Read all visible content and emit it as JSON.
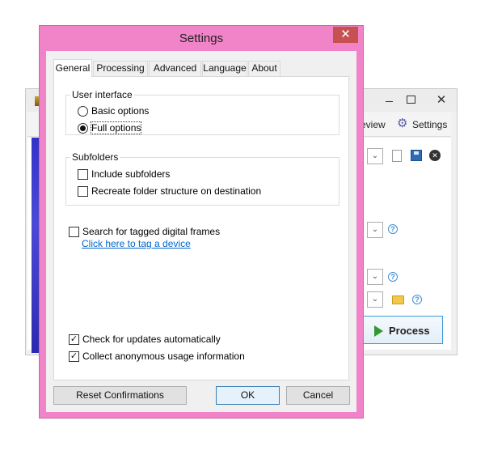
{
  "background_window": {
    "toolbar": {
      "review_label": "eview",
      "settings_label": "Settings"
    },
    "process_label": "Process",
    "close_glyph": "✕",
    "dropdown_glyph": "⌄",
    "help_glyph": "?",
    "delete_glyph": "✕",
    "icons": [
      "app-icon",
      "file-icon",
      "save-icon",
      "delete-icon",
      "folder-icon",
      "help-icon",
      "play-icon",
      "gear-icon"
    ]
  },
  "dialog": {
    "title": "Settings",
    "close_glyph": "✕",
    "accent_color": "#f183c8",
    "tabs": [
      {
        "label": "General",
        "active": true
      },
      {
        "label": "Processing"
      },
      {
        "label": "Advanced"
      },
      {
        "label": "Language"
      },
      {
        "label": "About"
      }
    ],
    "general": {
      "user_interface": {
        "legend": "User interface",
        "options": [
          {
            "label": "Basic options",
            "selected": false
          },
          {
            "label": "Full options",
            "selected": true
          }
        ]
      },
      "subfolders": {
        "legend": "Subfolders",
        "options": [
          {
            "label": "Include subfolders",
            "checked": false
          },
          {
            "label": "Recreate folder structure on destination",
            "checked": false
          }
        ]
      },
      "search_tagged": {
        "label": "Search for tagged digital frames",
        "checked": false
      },
      "tag_link": "Click here to tag a device",
      "check_updates": {
        "label": "Check for updates automatically",
        "checked": true
      },
      "collect_usage": {
        "label": "Collect anonymous usage information",
        "checked": true
      },
      "check_glyph": "✓"
    },
    "buttons": {
      "reset": "Reset Confirmations",
      "ok": "OK",
      "cancel": "Cancel"
    }
  }
}
